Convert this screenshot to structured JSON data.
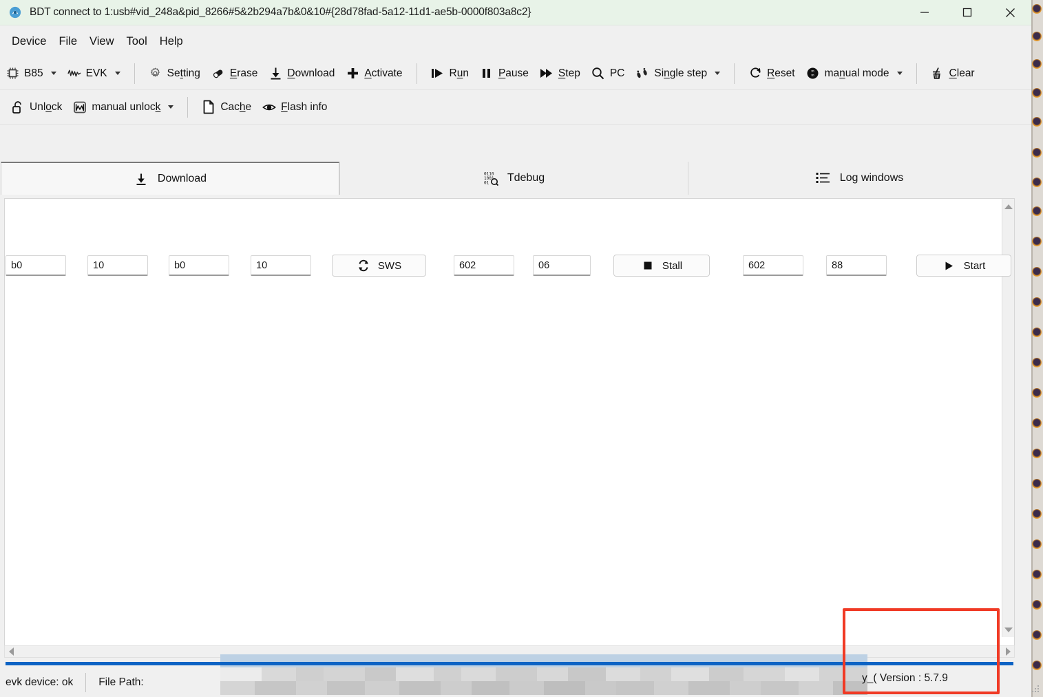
{
  "window": {
    "title": "BDT connect to 1:usb#vid_248a&pid_8266#5&2b294a7b&0&10#{28d78fad-5a12-11d1-ae5b-0000f803a8c2}",
    "app_icon": "bdt-app-icon",
    "minimize_label": "—",
    "maximize_label": "□",
    "close_label": "✕",
    "titlebar_color": "#e8f3e8"
  },
  "menubar": {
    "items": [
      {
        "label": "Device"
      },
      {
        "label": "File"
      },
      {
        "label": "View"
      },
      {
        "label": "Tool"
      },
      {
        "label": "Help"
      }
    ]
  },
  "toolbar_main": {
    "items": [
      {
        "label": "B85",
        "icon": "chip-icon",
        "dropdown": true
      },
      {
        "label": "EVK",
        "icon": "waveform-icon",
        "dropdown": true
      },
      {
        "separator": true
      },
      {
        "label": "Setting",
        "icon": "gear-icon",
        "accesskey": "t"
      },
      {
        "label": "Erase",
        "icon": "eraser-icon",
        "accesskey": "E"
      },
      {
        "label": "Download",
        "icon": "download-arrow-icon",
        "accesskey": "D"
      },
      {
        "label": "Activate",
        "icon": "plus-icon",
        "accesskey": "A"
      },
      {
        "separator": true
      },
      {
        "label": "Run",
        "icon": "run-icon",
        "accesskey": "u"
      },
      {
        "label": "Pause",
        "icon": "pause-icon",
        "accesskey": "P"
      },
      {
        "label": "Step",
        "icon": "step-forward-icon",
        "accesskey": "S"
      },
      {
        "label": "PC",
        "icon": "magnifier-icon"
      },
      {
        "label": "Single step",
        "icon": "footprints-icon",
        "dropdown": true,
        "accesskey": "n"
      },
      {
        "separator": true
      },
      {
        "label": "Reset",
        "icon": "reset-circular-arrow-icon",
        "accesskey": "R"
      },
      {
        "label": "manual mode",
        "icon": "mode-circle-icon",
        "dropdown": true,
        "accesskey": "u"
      },
      {
        "separator": true
      },
      {
        "label": "Clear",
        "icon": "broom-icon",
        "accesskey": "C"
      }
    ]
  },
  "toolbar_secondary": {
    "items": [
      {
        "label": "Unlock",
        "icon": "open-padlock-icon",
        "accesskey": "o"
      },
      {
        "label": "manual unlock",
        "icon": "envelope-m-icon",
        "dropdown": true,
        "accesskey": "k"
      },
      {
        "separator": true
      },
      {
        "label": "Cache",
        "icon": "page-icon",
        "accesskey": "h"
      },
      {
        "label": "Flash info",
        "icon": "eye-icon",
        "accesskey": "F"
      }
    ]
  },
  "param_row": {
    "fields": [
      {
        "name": "field-1",
        "value": "b0"
      },
      {
        "name": "field-2",
        "value": "10"
      },
      {
        "name": "field-3",
        "value": "b0"
      },
      {
        "name": "field-4",
        "value": "10"
      },
      {
        "name": "field-5",
        "value": "602"
      },
      {
        "name": "field-6",
        "value": "06"
      },
      {
        "name": "field-7",
        "value": "602"
      },
      {
        "name": "field-8",
        "value": "88"
      }
    ],
    "sws_button": {
      "label": "SWS",
      "icon": "refresh-icon"
    },
    "stall_button": {
      "label": "Stall",
      "icon": "stop-square-icon"
    },
    "start_button": {
      "label": "Start",
      "icon": "play-triangle-icon"
    }
  },
  "tabs": [
    {
      "label": "Download",
      "icon": "download-arrow-icon",
      "active": true
    },
    {
      "label": "Tdebug",
      "icon": "binary-magnifier-icon",
      "active": false
    },
    {
      "label": "Log windows",
      "icon": "list-lines-icon",
      "active": false
    }
  ],
  "content": {
    "log_text": "",
    "scroll_up_icon": "triangle-up-icon",
    "scroll_down_icon": "triangle-down-icon",
    "scroll_left_icon": "triangle-left-icon",
    "scroll_right_icon": "triangle-right-icon"
  },
  "statusbar": {
    "device_status": "evk device: ok",
    "file_path_label": "File Path:",
    "file_path_value": "",
    "version": "y_( Version : 5.7.9"
  },
  "annotation": {
    "color": "#f03a25",
    "target": "version-text"
  }
}
